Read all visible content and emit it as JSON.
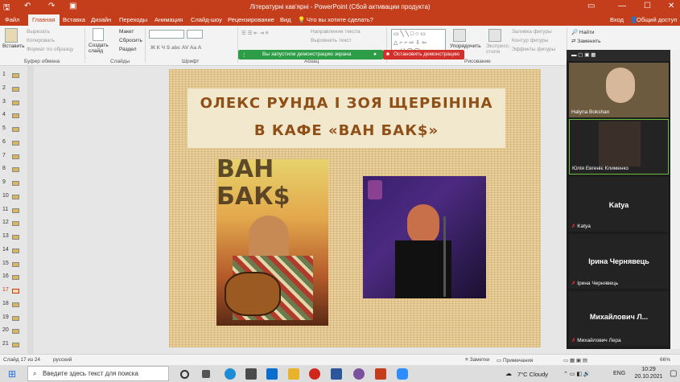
{
  "titlebar": {
    "title": "Літературні кав'ярні - PowerPoint (Сбой активации продукта)",
    "signin": "Вход",
    "share": "Общий доступ"
  },
  "tabs": [
    "Файл",
    "Главная",
    "Вставка",
    "Дизайн",
    "Переходы",
    "Анимация",
    "Слайд-шоу",
    "Рецензирование",
    "Вид",
    "Что вы хотите сделать?"
  ],
  "ribbon": {
    "paste": "Вставить",
    "cut": "Вырезать",
    "copy": "Копировать",
    "format_painter": "Формат по образцу",
    "clipboard": "Буфер обмена",
    "new_slide": "Создать слайд",
    "layout": "Макет",
    "reset": "Сбросить",
    "section": "Раздел",
    "slides": "Слайды",
    "font": "Шрифт",
    "paragraph": "Абзац",
    "text_direction": "Направление текста",
    "align_text": "Выровнять текст",
    "smartart": "Преобразовать в SmartArt",
    "arrange": "Упорядочить",
    "quick_styles": "Экспресс-стили",
    "shape_fill": "Заливка фигуры",
    "shape_outline": "Контур фигуры",
    "shape_effects": "Эффекты фигуры",
    "drawing": "Рисование",
    "find": "Найти",
    "replace": "Заменить",
    "select": "Выделить"
  },
  "share_bar": {
    "running": "Вы запустили демонстрацию экрана",
    "stop": "Остановить демонстрацию"
  },
  "slide": {
    "title_line1": "ОЛЕКС РУНДА І ЗОЯ ЩЕРБІНІНА",
    "title_line2": "В КАФЕ «ВАН БАК$»",
    "photo1_text": "ВАН БАК$"
  },
  "thumbs": [
    "1",
    "2",
    "3",
    "4",
    "5",
    "6",
    "7",
    "8",
    "9",
    "10",
    "11",
    "12",
    "13",
    "14",
    "15",
    "16",
    "17",
    "18",
    "19",
    "20",
    "21"
  ],
  "participants": [
    {
      "name": "Halyna Bokshan",
      "type": "video"
    },
    {
      "name": "Юлія Евгеніє Клименко",
      "type": "video"
    },
    {
      "name": "Katya",
      "big": "Katya",
      "type": "name"
    },
    {
      "name": "Ірина Чернявець",
      "big": "Ірина Чернявець",
      "type": "name"
    },
    {
      "name": "Михайлович Лера",
      "big": "Михайлович Л...",
      "type": "name"
    }
  ],
  "status": {
    "slide": "Слайд 17 из 24",
    "lang": "русский",
    "notes": "Заметки",
    "comments": "Примечания",
    "zoom": "66%"
  },
  "taskbar": {
    "search": "Введите здесь текст для поиска",
    "weather": "7°C Cloudy",
    "lang": "ENG",
    "time": "10:29",
    "date": "20.10.2021"
  }
}
